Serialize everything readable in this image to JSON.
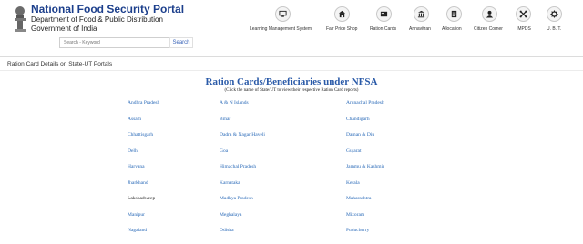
{
  "header": {
    "title": "National Food Security Portal",
    "department": "Department of Food & Public Distribution",
    "government": "Government of India"
  },
  "search": {
    "placeholder": "Search - Keyword",
    "button_label": "Search"
  },
  "nav": [
    {
      "label": "Learning Management System",
      "icon": "monitor-icon"
    },
    {
      "label": "Fair Price Shop",
      "icon": "shop-icon"
    },
    {
      "label": "Ration Cards",
      "icon": "card-icon"
    },
    {
      "label": "Annavitran",
      "icon": "building-icon"
    },
    {
      "label": "Allocation",
      "icon": "document-icon"
    },
    {
      "label": "Citizen Corner",
      "icon": "user-icon"
    },
    {
      "label": "IMPDS",
      "icon": "arrows-icon"
    },
    {
      "label": "U. B. T.",
      "icon": "gear-icon"
    }
  ],
  "breadcrumb": "Ration Card Details on State-UT Portals",
  "main": {
    "title": "Ration Cards/Beneficiaries under NFSA",
    "subtitle": "(Click the name of State/UT to view their respective Ration Card reports)"
  },
  "states": [
    "Andhra Pradesh",
    "A & N Islands",
    "Arunachal Pradesh",
    "Assam",
    "Bihar",
    "Chandigarh",
    "Chhattisgarh",
    "Dadra & Nagar Haveli",
    "Daman & Diu",
    "Delhi",
    "Goa",
    "Gujarat",
    "Haryana",
    "Himachal Pradesh",
    "Jammu & Kashmir",
    "Jharkhand",
    "Karnataka",
    "Kerala",
    "Lakshadweep",
    "Madhya Pradesh",
    "Maharashtra",
    "Manipur",
    "Meghalaya",
    "Mizoram",
    "Nagaland",
    "Odisha",
    "Puducherry"
  ],
  "colors": {
    "brand_blue": "#1c3f8c",
    "link_blue": "#2a6ab8",
    "title_blue": "#2a5aa8"
  }
}
